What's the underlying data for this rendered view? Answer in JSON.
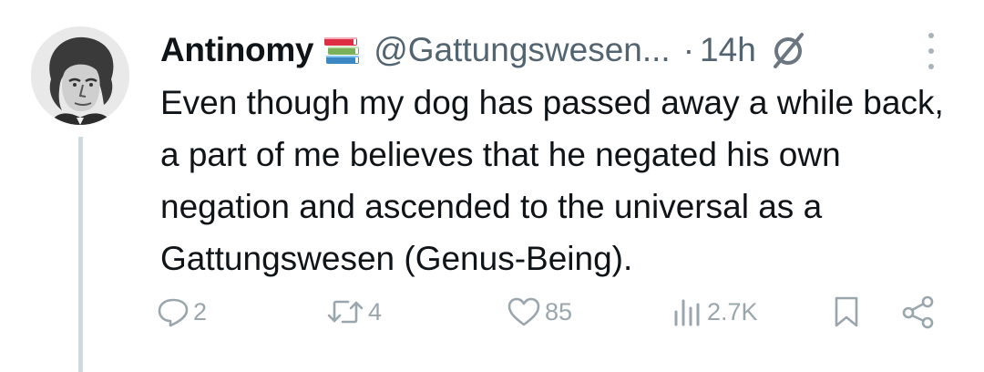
{
  "tweet": {
    "display_name": "Antinomy",
    "name_emoji": "books-emoji",
    "handle": "@Gattungswesen...",
    "dot": "·",
    "time": "14h",
    "text": "Even though my dog has passed away a while back, a part of me believes that he negated his own negation and ascended to the universal as a Gattungswesen (Genus-Being).",
    "actions": {
      "replies": "2",
      "retweets": "4",
      "likes": "85",
      "views": "2.7K"
    }
  },
  "icons": {
    "edited": "empty-set-icon",
    "more": "more-vertical-icon",
    "reply": "reply-icon",
    "retweet": "retweet-icon",
    "like": "heart-icon",
    "views": "views-chart-icon",
    "bookmark": "bookmark-icon",
    "share": "share-icon"
  },
  "colors": {
    "text": "#0f1419",
    "secondary": "#536471",
    "icon": "#9aa6ae",
    "thread_line": "#cfd9de",
    "background": "#ffffff"
  }
}
